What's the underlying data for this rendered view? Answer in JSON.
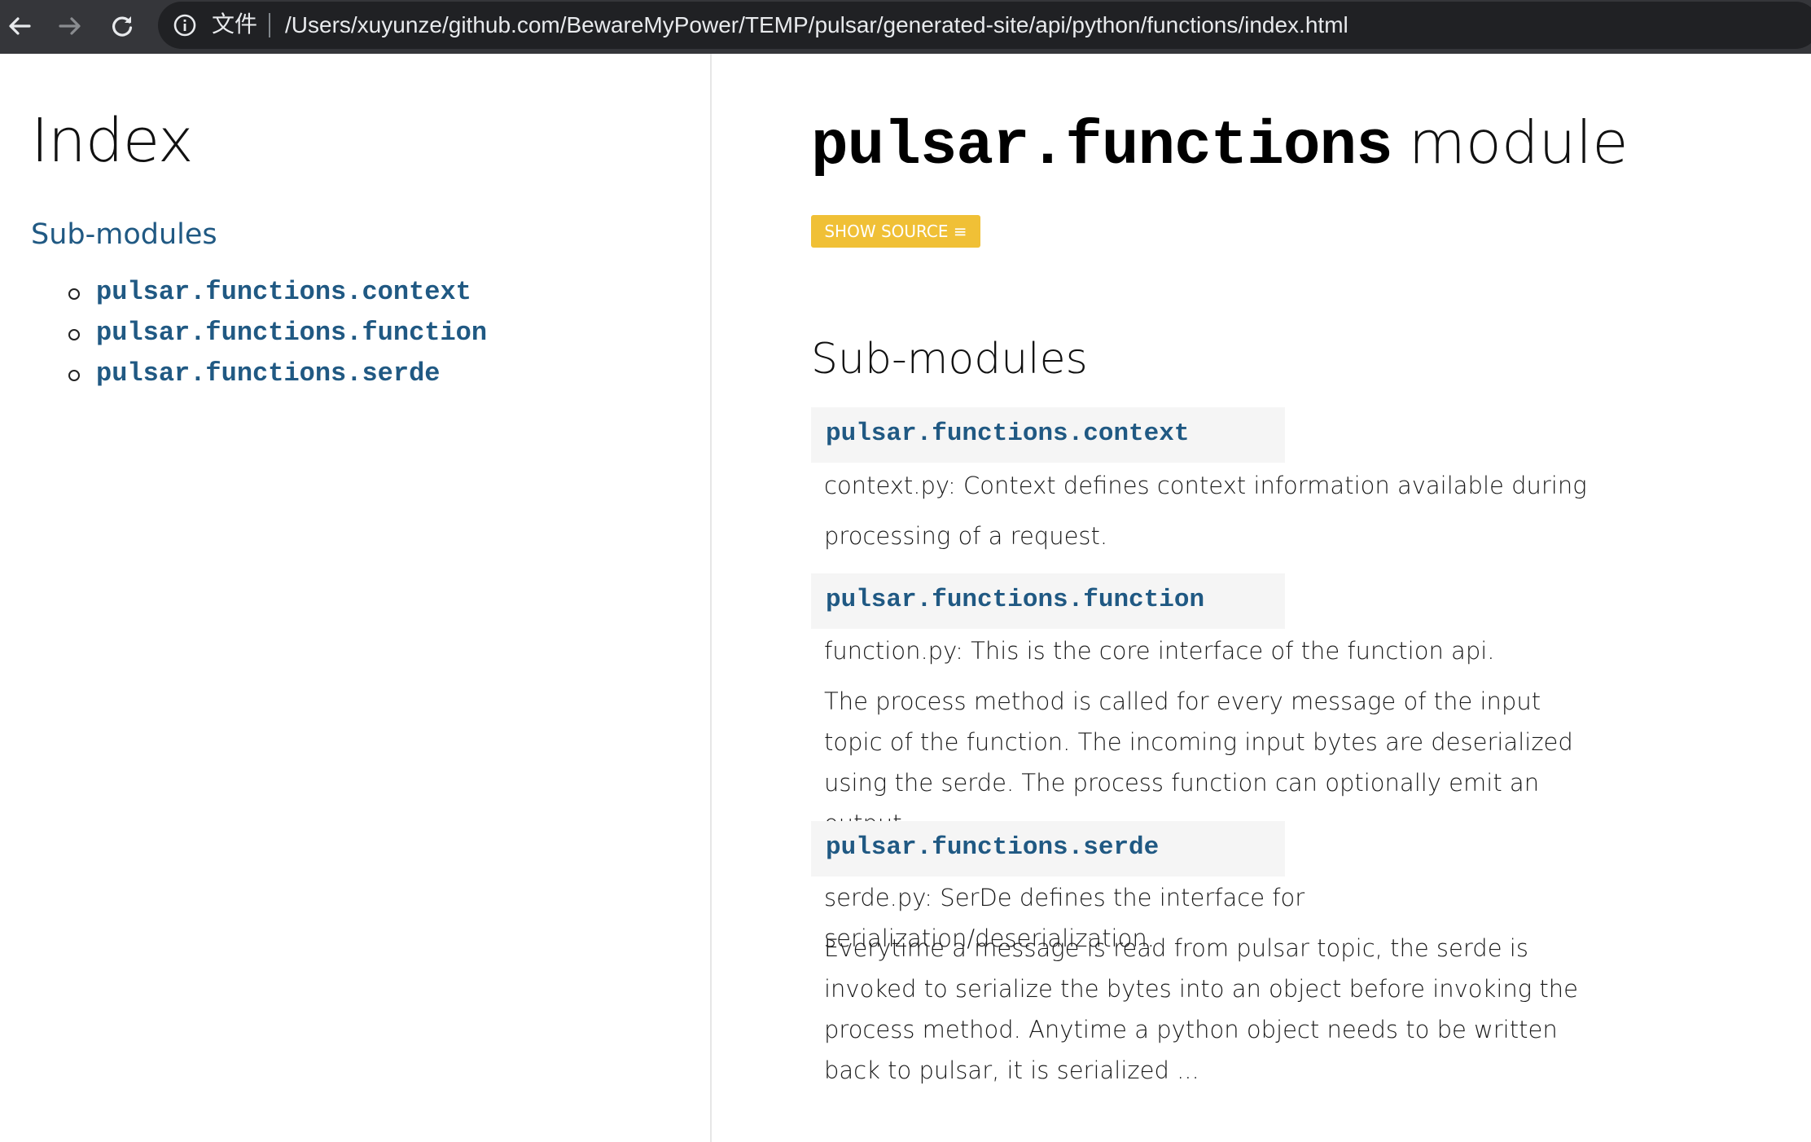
{
  "browser": {
    "label": "文件",
    "url": "/Users/xuyunze/github.com/BewareMyPower/TEMP/pulsar/generated-site/api/python/functions/index.html"
  },
  "sidebar": {
    "title": "Index",
    "section": "Sub-modules",
    "items": [
      "pulsar.functions.context",
      "pulsar.functions.function",
      "pulsar.functions.serde"
    ]
  },
  "main": {
    "module_name": "pulsar.functions",
    "module_word": "module",
    "show_source": "SHOW SOURCE ≡",
    "section": "Sub-modules",
    "submodules": [
      {
        "name": "pulsar.functions.context",
        "paragraphs": [
          "context.py: Context defines context information available during processing of a request."
        ]
      },
      {
        "name": "pulsar.functions.function",
        "paragraphs": [
          "function.py: This is the core interface of the function api.",
          "The process method is called for every message of the input topic of the function. The incoming input bytes are deserialized using the serde. The process function can optionally emit an output"
        ]
      },
      {
        "name": "pulsar.functions.serde",
        "paragraphs": [
          "serde.py: SerDe defines the interface for serialization/deserialization.",
          "Everytime a message is read from pulsar topic, the serde is invoked to serialize the bytes into an object before invoking the process method. Anytime a python object needs to be written back to pulsar, it is serialized ..."
        ]
      }
    ]
  },
  "colors": {
    "link": "#205983",
    "button": "#f0c036",
    "toolbar": "#35363a"
  }
}
